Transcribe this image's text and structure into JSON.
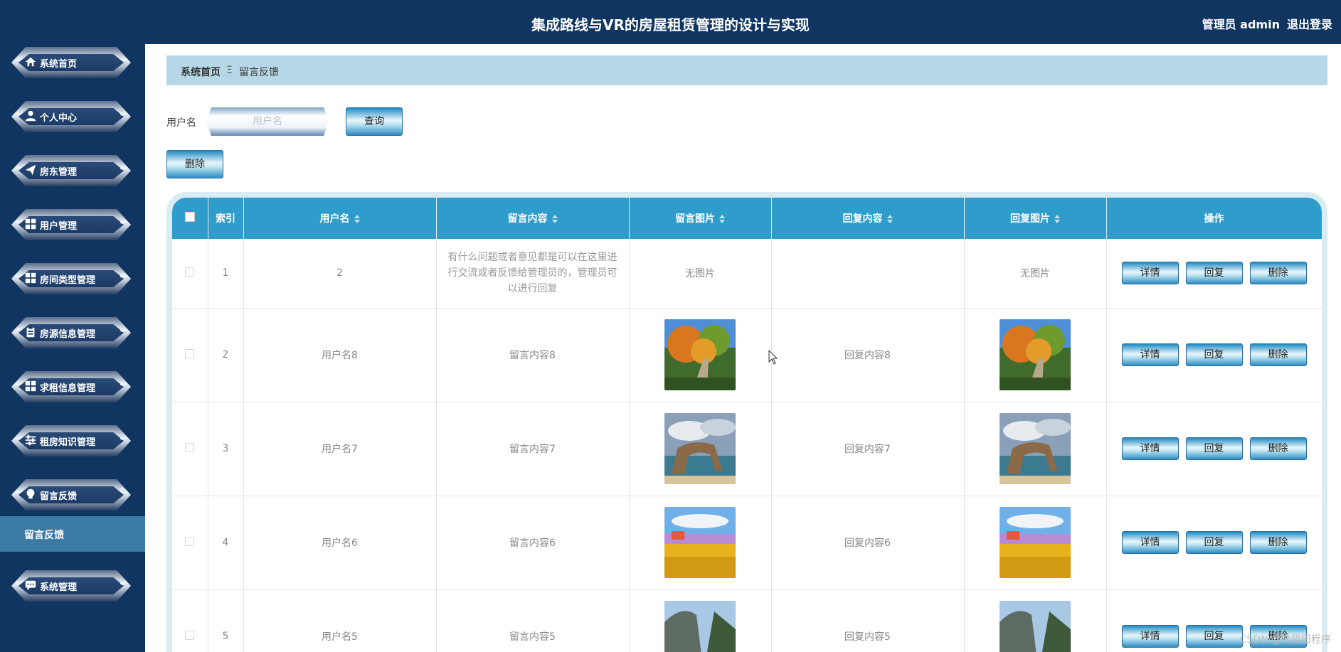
{
  "header": {
    "title": "集成路线与VR的房屋租赁管理的设计与实现",
    "user_label": "管理员 admin",
    "logout_label": "退出登录"
  },
  "sidebar": {
    "items": [
      {
        "label": "系统首页",
        "icon": "home-icon",
        "chevron": ""
      },
      {
        "label": "个人中心",
        "icon": "user-icon",
        "chevron": "⌄"
      },
      {
        "label": "房东管理",
        "icon": "paper-plane-icon",
        "chevron": "⌄"
      },
      {
        "label": "用户管理",
        "icon": "grid-icon",
        "chevron": "⌄"
      },
      {
        "label": "房间类型管理",
        "icon": "grid-icon",
        "chevron": "⌄"
      },
      {
        "label": "房源信息管理",
        "icon": "clipboard-icon",
        "chevron": "⌄"
      },
      {
        "label": "求租信息管理",
        "icon": "grid-icon",
        "chevron": "⌄"
      },
      {
        "label": "租房知识管理",
        "icon": "sliders-icon",
        "chevron": "⌄"
      },
      {
        "label": "留言反馈",
        "icon": "lightbulb-icon",
        "chevron": "⌃"
      },
      {
        "label": "系统管理",
        "icon": "chat-icon",
        "chevron": "⌄"
      }
    ],
    "active_sub": "留言反馈"
  },
  "breadcrumb": {
    "home": "系统首页",
    "separator": "Ξ",
    "current": "留言反馈"
  },
  "search": {
    "label": "用户名",
    "placeholder": "用户名",
    "query_button": "查询",
    "delete_button": "删除"
  },
  "table": {
    "columns": [
      "索引",
      "用户名",
      "留言内容",
      "留言图片",
      "回复内容",
      "回复图片",
      "操作"
    ],
    "rows": [
      {
        "index": "1",
        "username": "2",
        "content": "有什么问题或者意见都是可以在这里进行交流或者反馈给管理员的，管理员可以进行回复",
        "image": "无图片",
        "reply": "",
        "reply_image": "无图片"
      },
      {
        "index": "2",
        "username": "用户名8",
        "content": "留言内容8",
        "image": "autumn-stairs",
        "reply": "回复内容8",
        "reply_image": "autumn-stairs"
      },
      {
        "index": "3",
        "username": "用户名7",
        "content": "留言内容7",
        "image": "sea-arch",
        "reply": "回复内容7",
        "reply_image": "sea-arch"
      },
      {
        "index": "4",
        "username": "用户名6",
        "content": "留言内容6",
        "image": "flower-field",
        "reply": "回复内容6",
        "reply_image": "flower-field"
      },
      {
        "index": "5",
        "username": "用户名5",
        "content": "留言内容5",
        "image": "mountain-cliff",
        "reply": "回复内容5",
        "reply_image": "mountain-cliff"
      }
    ],
    "actions": [
      "详情",
      "回复",
      "删除"
    ]
  },
  "watermark": "CSDN @熊猫阳程序",
  "colors": {
    "nav_bg": "#0f3560",
    "table_header": "#2e9dcb",
    "breadcrumb_bg": "#b6d8e6",
    "submenu_active": "#3a7aa3"
  }
}
